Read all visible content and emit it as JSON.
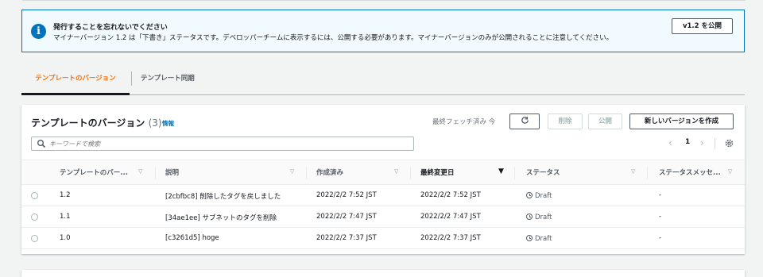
{
  "alert": {
    "title": "発行することを忘れないでください",
    "message": "マイナーバージョン 1.2 は「下書き」ステータスです。デベロッパーチームに表示するには、公開する必要があります。マイナーバージョンのみが公開されることに注意してください。",
    "publish_button": "v1.2 を公開",
    "icon": "info-icon"
  },
  "tabs": [
    {
      "label": "テンプレートのバージョン",
      "active": true
    },
    {
      "label": "テンプレート同期",
      "active": false
    }
  ],
  "panel": {
    "title": "テンプレートのバージョン",
    "count": "(3)",
    "info_link": "情報",
    "fetch_text": "最終フェッチ済み 今",
    "delete_button": "削除",
    "publish_button": "公開",
    "create_button": "新しいバージョンを作成",
    "search_placeholder": "キーワードで検索",
    "page_number": "1"
  },
  "columns": [
    "テンプレートのバー...",
    "説明",
    "作成済み",
    "最終変更日",
    "ステータス",
    "ステータスメッセ..."
  ],
  "rows": [
    {
      "version": "1.2",
      "description": "[2cbfbc8] 削除したタグを戻しました",
      "created": "2022/2/2 7:52 JST",
      "modified": "2022/2/2 7:52 JST",
      "status": "Draft",
      "status_message": "-"
    },
    {
      "version": "1.1",
      "description": "[34ae1ee] サブネットのタグを削除",
      "created": "2022/2/2 7:47 JST",
      "modified": "2022/2/2 7:47 JST",
      "status": "Draft",
      "status_message": "-"
    },
    {
      "version": "1.0",
      "description": "[c3261d5] hoge",
      "created": "2022/2/2 7:37 JST",
      "modified": "2022/2/2 7:37 JST",
      "status": "Draft",
      "status_message": "-"
    }
  ],
  "colors": {
    "accent": "#ec7211",
    "link": "#0073bb",
    "alert_bg": "#f1faff"
  }
}
